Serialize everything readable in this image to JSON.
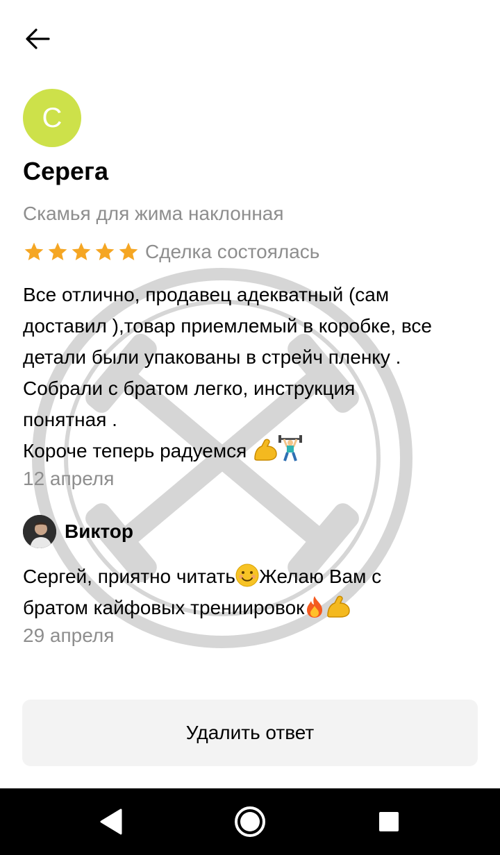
{
  "review": {
    "avatar_letter": "С",
    "author": "Серега",
    "product": "Скамья для жима наклонная",
    "rating": 5,
    "status": "Сделка состоялась",
    "text_lines": [
      "Все отлично, продавец адекватный (сам",
      "доставил ),товар приемлемый в коробке, все",
      "детали были упакованы в стрейч пленку .",
      "Собрали с братом легко, инструкция",
      "понятная .",
      "Короче теперь радуемся "
    ],
    "date": "12 апреля"
  },
  "reply": {
    "author": "Виктор",
    "text_lines": [
      "Сергей, приятно читать",
      "Желаю Вам с",
      "братом кайфовых трениировок"
    ],
    "date": "29 апреля"
  },
  "actions": {
    "delete_reply_label": "Удалить ответ"
  },
  "colors": {
    "avatar_bg": "#cde14a",
    "star": "#f5a623",
    "secondary_text": "#8e8e8e",
    "button_bg": "#f3f3f3",
    "navbar_bg": "#000000"
  },
  "icons": {
    "back": "arrow-left-icon",
    "star": "star-icon",
    "nav_back": "triangle-back-icon",
    "nav_home": "circle-home-icon",
    "nav_recents": "square-recents-icon"
  }
}
